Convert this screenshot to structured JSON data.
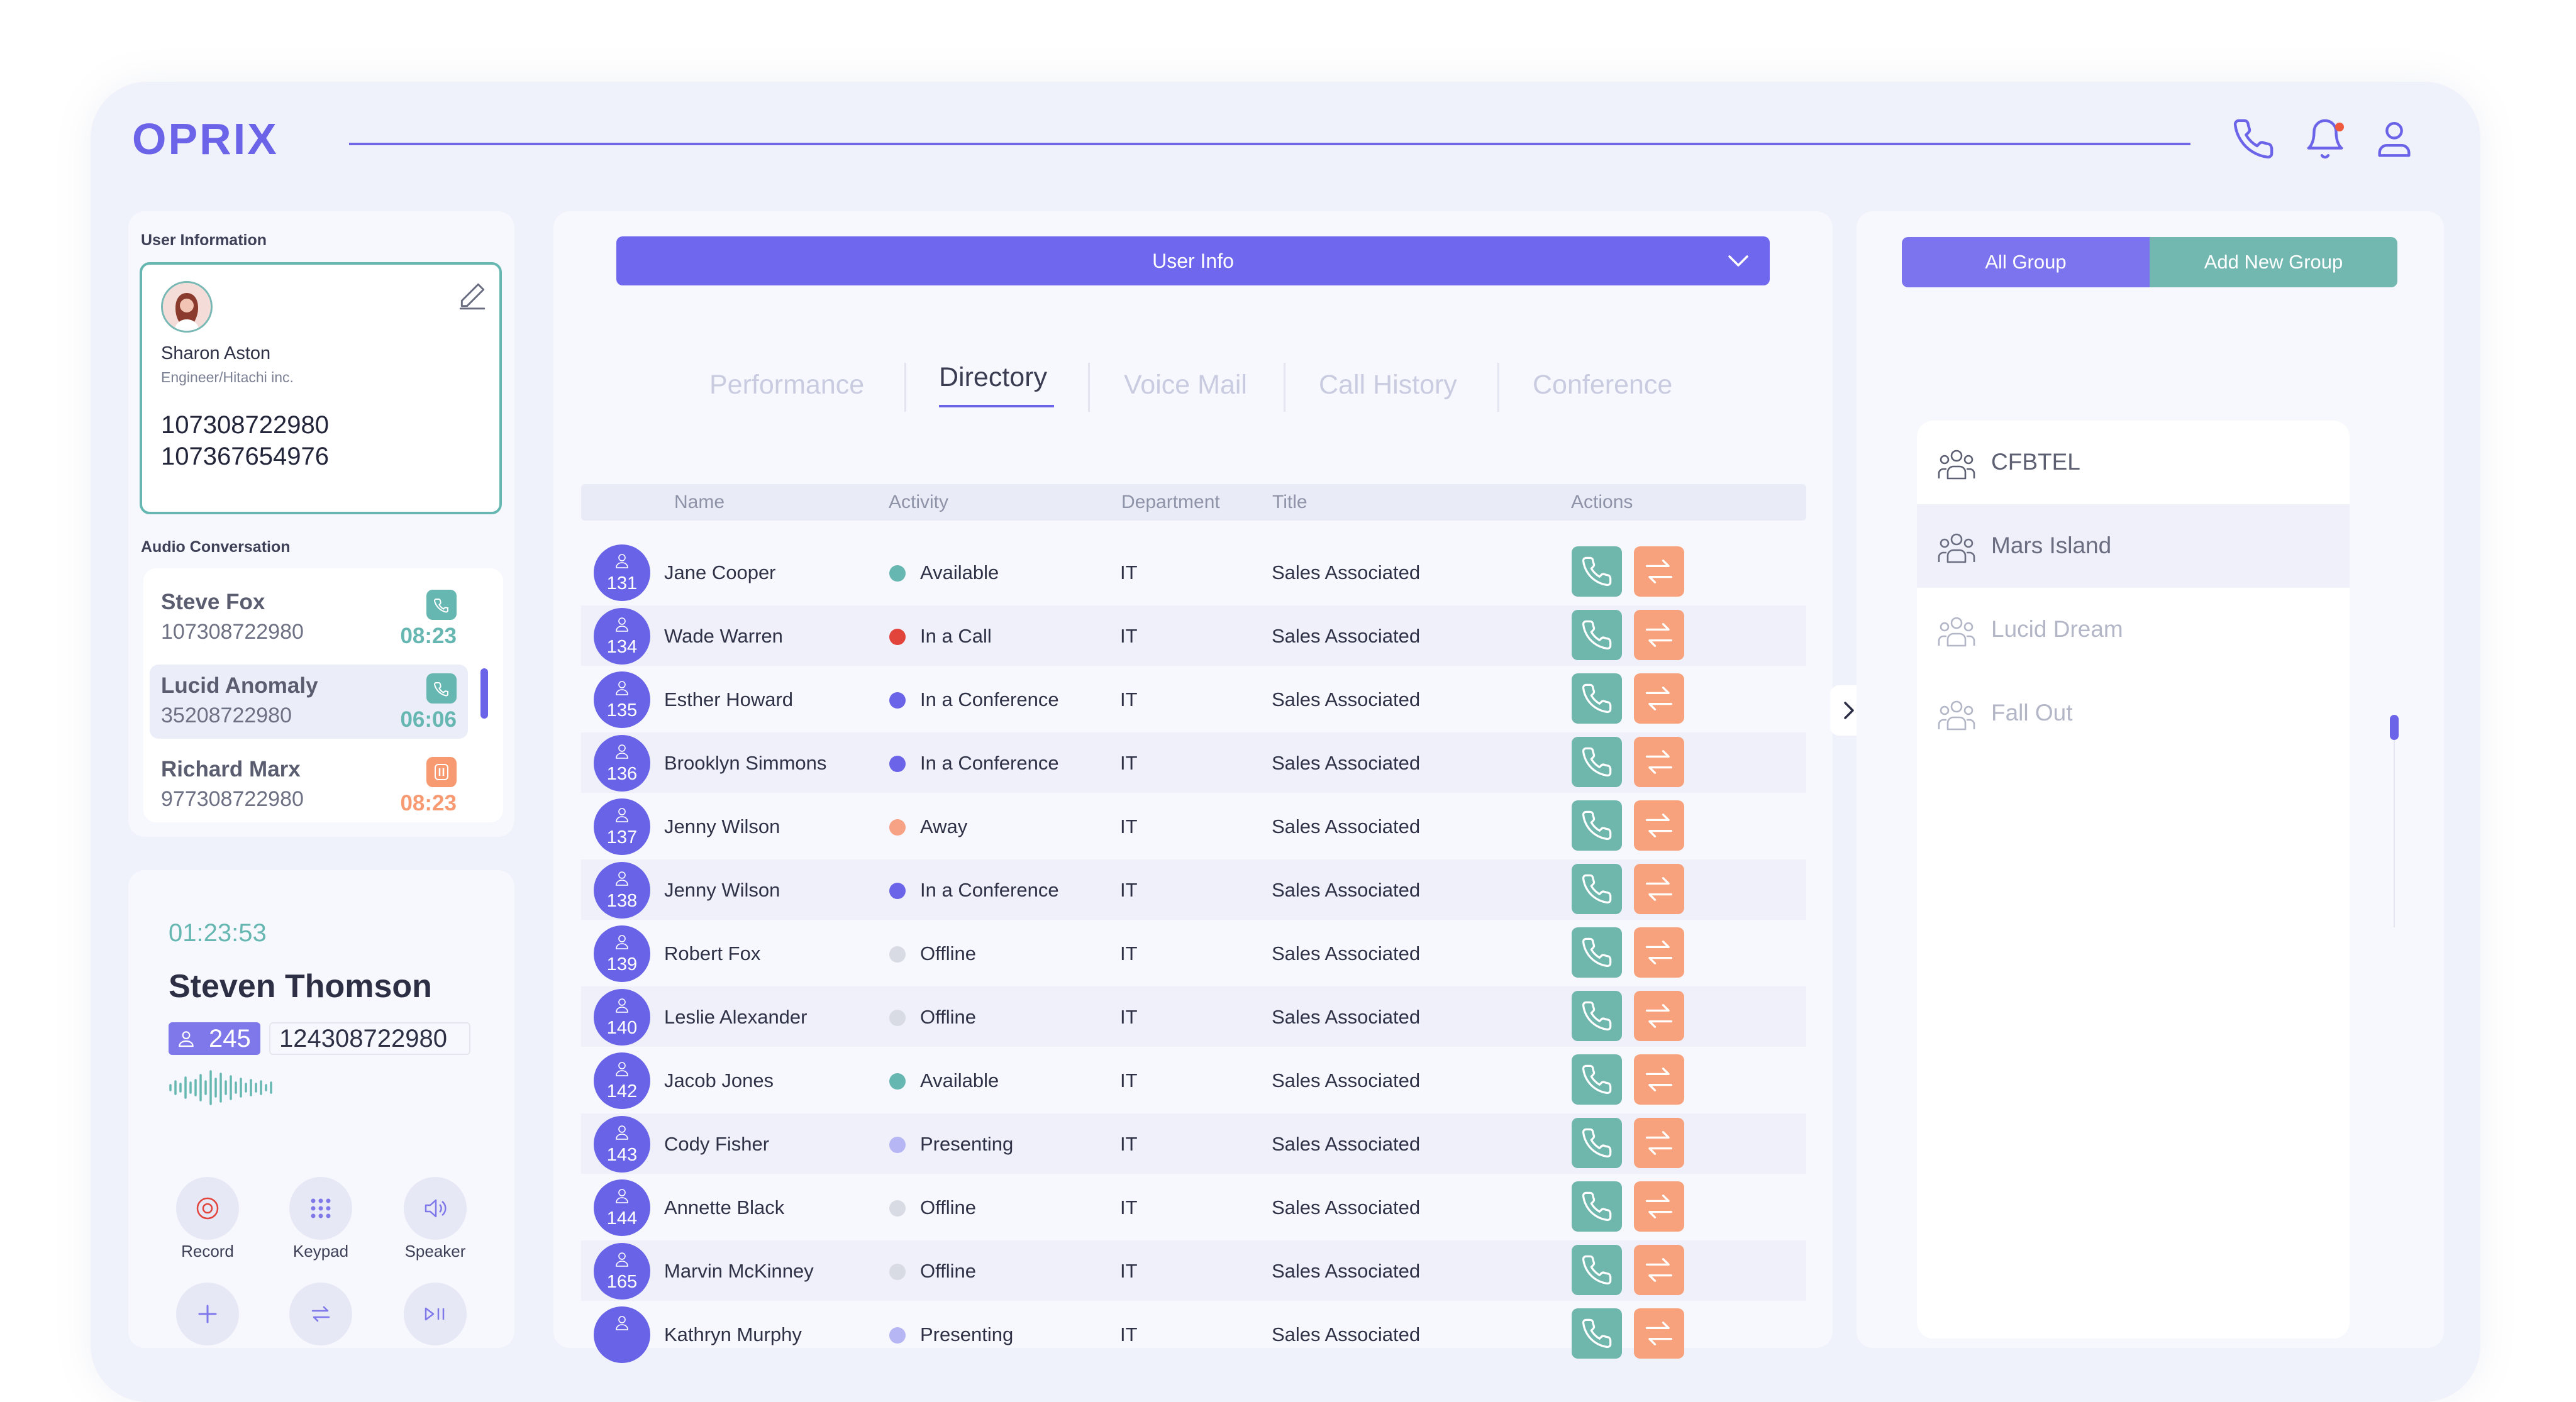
{
  "app": {
    "logo": "OPRIX"
  },
  "header": {
    "icons": [
      "phone-icon",
      "bell-icon",
      "user-icon"
    ]
  },
  "user_info": {
    "title": "User Information",
    "name": "Sharon Aston",
    "role": "Engineer/Hitachi inc.",
    "phone_1": "107308722980",
    "phone_2": "107367654976"
  },
  "audio_conversation": {
    "title": "Audio Conversation",
    "items": [
      {
        "name": "Steve Fox",
        "number": "107308722980",
        "time": "08:23",
        "status": "phone",
        "color": "#66b7b2"
      },
      {
        "name": "Lucid Anomaly",
        "number": "35208722980",
        "time": "06:06",
        "status": "phone",
        "color": "#66b7b2"
      },
      {
        "name": "Richard Marx",
        "number": "977308722980",
        "time": "08:23",
        "status": "paused",
        "color": "#f79a72"
      }
    ]
  },
  "call": {
    "timer": "01:23:53",
    "name": "Steven Thomson",
    "ext": "245",
    "number": "124308722980",
    "controls": [
      {
        "label": "Record",
        "icon": "record-icon"
      },
      {
        "label": "Keypad",
        "icon": "keypad-icon"
      },
      {
        "label": "Speaker",
        "icon": "speaker-icon"
      }
    ]
  },
  "center": {
    "dropdown": "User Info",
    "tabs": [
      "Performance",
      "Directory",
      "Voice Mail",
      "Call History",
      "Conference"
    ],
    "active_tab": "Directory",
    "columns": [
      "Name",
      "Activity",
      "Department",
      "Title",
      "Actions"
    ],
    "rows": [
      {
        "ext": "131",
        "name": "Jane Cooper",
        "activity": "Available",
        "activity_color": "#66b7b2",
        "dept": "IT",
        "title": "Sales Associated"
      },
      {
        "ext": "134",
        "name": "Wade Warren",
        "activity": "In a Call",
        "activity_color": "#e2443b",
        "dept": "IT",
        "title": "Sales Associated"
      },
      {
        "ext": "135",
        "name": "Esther Howard",
        "activity": "In a Conference",
        "activity_color": "#6b63e8",
        "dept": "IT",
        "title": "Sales Associated"
      },
      {
        "ext": "136",
        "name": "Brooklyn Simmons",
        "activity": "In a Conference",
        "activity_color": "#6b63e8",
        "dept": "IT",
        "title": "Sales Associated"
      },
      {
        "ext": "137",
        "name": "Jenny Wilson",
        "activity": "Away",
        "activity_color": "#f7a185",
        "dept": "IT",
        "title": "Sales Associated"
      },
      {
        "ext": "138",
        "name": "Jenny Wilson",
        "activity": "In a Conference",
        "activity_color": "#6b63e8",
        "dept": "IT",
        "title": "Sales Associated"
      },
      {
        "ext": "139",
        "name": "Robert Fox",
        "activity": "Offline",
        "activity_color": "#d9dbe4",
        "dept": "IT",
        "title": "Sales Associated"
      },
      {
        "ext": "140",
        "name": "Leslie Alexander",
        "activity": "Offline",
        "activity_color": "#d9dbe4",
        "dept": "IT",
        "title": "Sales Associated"
      },
      {
        "ext": "142",
        "name": "Jacob Jones",
        "activity": "Available",
        "activity_color": "#66b7b2",
        "dept": "IT",
        "title": "Sales Associated"
      },
      {
        "ext": "143",
        "name": "Cody Fisher",
        "activity": "Presenting",
        "activity_color": "#b6b6f4",
        "dept": "IT",
        "title": "Sales Associated"
      },
      {
        "ext": "144",
        "name": "Annette Black",
        "activity": "Offline",
        "activity_color": "#d9dbe4",
        "dept": "IT",
        "title": "Sales Associated"
      },
      {
        "ext": "165",
        "name": "Marvin McKinney",
        "activity": "Offline",
        "activity_color": "#d9dbe4",
        "dept": "IT",
        "title": "Sales Associated"
      },
      {
        "ext": "",
        "name": "Kathryn Murphy",
        "activity": "Presenting",
        "activity_color": "#b6b6f4",
        "dept": "IT",
        "title": "Sales Associated"
      }
    ]
  },
  "groups": {
    "all_label": "All Group",
    "add_label": "Add New Group",
    "items": [
      {
        "name": "CFBTEL",
        "color": "#5d6072",
        "selected": false
      },
      {
        "name": "Mars Island",
        "color": "#6a6d80",
        "selected": true
      },
      {
        "name": "Lucid Dream",
        "color": "#b3b6c6",
        "selected": false
      },
      {
        "name": "Fall Out",
        "color": "#b3b6c6",
        "selected": false
      }
    ]
  },
  "colors": {
    "accent": "#6b63e8",
    "teal": "#66b7b2",
    "orange": "#f8a27d",
    "background": "#eff1fb"
  }
}
